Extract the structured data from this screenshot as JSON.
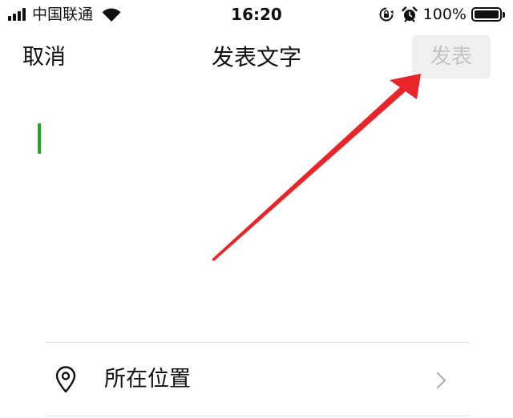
{
  "status_bar": {
    "carrier": "中国联通",
    "time": "16:20",
    "battery_percent": "100%",
    "battery_level": 1.0,
    "signal_bars": 4,
    "icons": [
      "signal-icon",
      "wifi-icon",
      "rotation-lock-icon",
      "alarm-icon",
      "battery-icon"
    ]
  },
  "nav": {
    "cancel_label": "取消",
    "title": "发表文字",
    "publish_label": "发表",
    "publish_enabled": false
  },
  "editor": {
    "value": "",
    "caret_color": "#1aad19"
  },
  "location": {
    "label": "所在位置",
    "icon": "location-pin-icon",
    "trailing_icon": "chevron-right-icon"
  },
  "annotation": {
    "type": "arrow",
    "color": "#e8262a",
    "points_to": "publish-button"
  },
  "colors": {
    "background": "#ffffff",
    "text": "#111111",
    "publish_disabled_bg": "#efefef",
    "publish_disabled_text": "#c3c3c3",
    "divider": "#e2e2e2",
    "chevron": "#b0b0b0"
  }
}
